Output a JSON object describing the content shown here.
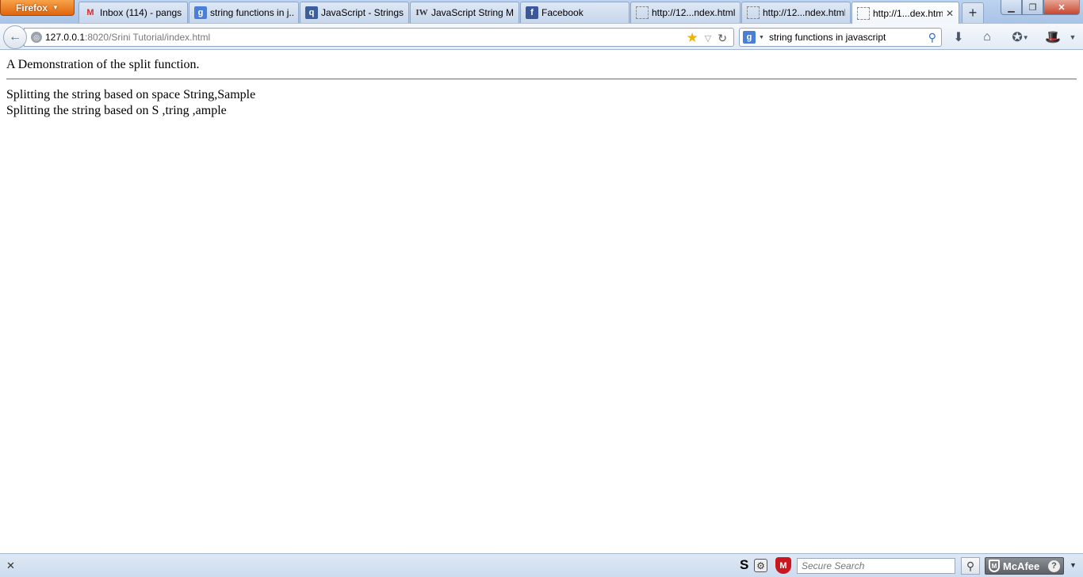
{
  "browser": {
    "menu_button_label": "Firefox",
    "tabs": [
      {
        "label": "Inbox (114) - pangs...",
        "icon": "gmail-icon"
      },
      {
        "label": "string functions in j...",
        "icon": "google-icon"
      },
      {
        "label": "JavaScript - Strings",
        "icon": "tutorial-site-icon"
      },
      {
        "label": "JavaScript String M...",
        "icon": "iw-icon"
      },
      {
        "label": "Facebook",
        "icon": "facebook-icon"
      },
      {
        "label": "http://12...ndex.html",
        "icon": "blank-page-icon"
      },
      {
        "label": "http://12...ndex.html",
        "icon": "blank-page-icon"
      },
      {
        "label": "http://1...dex.html",
        "icon": "blank-page-icon",
        "active": true
      }
    ],
    "url": {
      "host": "127.0.0.1",
      "path": ":8020/Srini Tutorial/index.html"
    },
    "search": {
      "engine": "Google",
      "value": "string functions in javascript"
    }
  },
  "page": {
    "heading": "A Demonstration of the split function.",
    "line1": "Splitting the string based on space String,Sample",
    "line2": "Splitting the string based on S ,tring ,ample"
  },
  "addon_bar": {
    "secure_search_placeholder": "Secure Search",
    "mcafee_label": "McAfee"
  }
}
